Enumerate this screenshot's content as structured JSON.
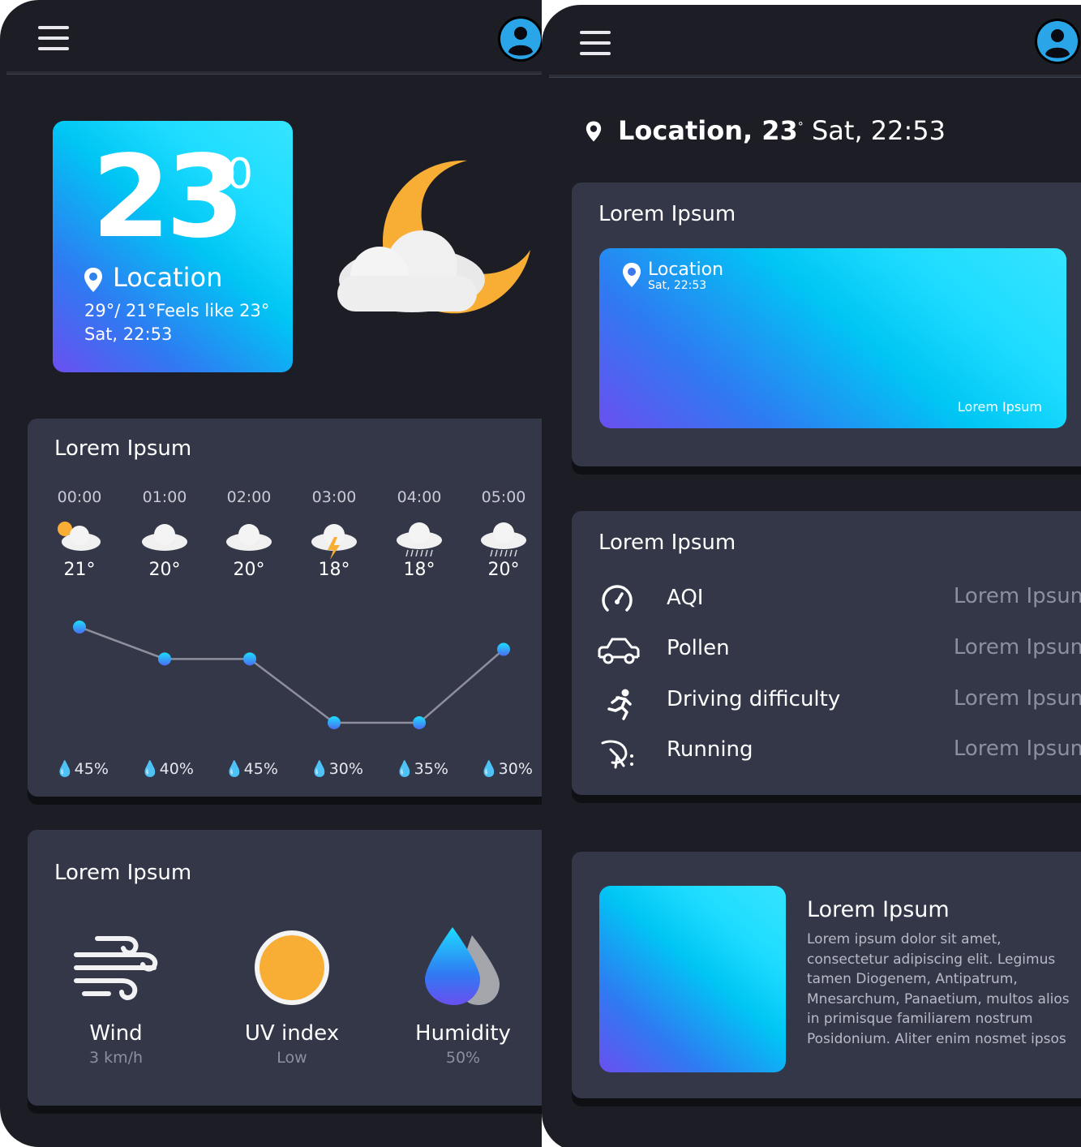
{
  "left": {
    "current": {
      "temperature": "23",
      "degree": "0",
      "location": "Location",
      "range_feels": "29°/ 21°Feels like 23°",
      "datetime": "Sat, 22:53"
    },
    "hourly": {
      "title": "Lorem Ipsum",
      "hours": [
        {
          "time": "00:00",
          "icon": "partly-cloudy-night-icon",
          "temp": "21°",
          "humidity": "45%"
        },
        {
          "time": "01:00",
          "icon": "cloud-icon",
          "temp": "20°",
          "humidity": "40%"
        },
        {
          "time": "02:00",
          "icon": "cloud-icon",
          "temp": "20°",
          "humidity": "45%"
        },
        {
          "time": "03:00",
          "icon": "thunderstorm-icon",
          "temp": "18°",
          "humidity": "30%"
        },
        {
          "time": "04:00",
          "icon": "rain-icon",
          "temp": "18°",
          "humidity": "35%"
        },
        {
          "time": "05:00",
          "icon": "rain-icon",
          "temp": "20°",
          "humidity": "30%"
        }
      ],
      "trend_values": [
        21,
        20,
        20,
        18,
        18,
        20.3
      ]
    },
    "details": {
      "title": "Lorem Ipsum",
      "items": [
        {
          "label": "Wind",
          "value": "3 km/h",
          "icon": "wind-icon"
        },
        {
          "label": "UV index",
          "value": "Low",
          "icon": "sun-icon"
        },
        {
          "label": "Humidity",
          "value": "50%",
          "icon": "humidity-drops-icon"
        }
      ]
    }
  },
  "right": {
    "header": {
      "location": "Location, 23",
      "degree": "°",
      "datetime": " Sat, 22:53"
    },
    "feature": {
      "title": "Lorem Ipsum",
      "location": "Location",
      "datetime": "Sat, 22:53",
      "link": "Lorem Ipsum"
    },
    "activities": {
      "title": "Lorem Ipsum",
      "rows": [
        {
          "icon": "speedometer-icon",
          "label": "AQI",
          "value": "Lorem Ipsum"
        },
        {
          "icon": "car-icon",
          "label": "Pollen",
          "value": "Lorem Ipsum"
        },
        {
          "icon": "running-person-icon",
          "label": "Driving difficulty",
          "value": "Lorem Ipsum"
        },
        {
          "icon": "flower-icon",
          "label": "Running",
          "value": "Lorem Ipsum"
        }
      ]
    },
    "article": {
      "title": "Lorem Ipsum",
      "body": "Lorem ipsum dolor sit amet, consectetur adipiscing elit. Legimus tamen Diogenem, Antipatrum, Mnesarchum, Panaetium, multos alios in primisque familiarem nostrum Posidonium. Aliter enim nosmet ipsos"
    }
  },
  "colors": {
    "background": "#1d1e25",
    "card": "#333748",
    "accent_cyan": "#1edcff",
    "accent_violet": "#6a4ff0",
    "moon": "#f8ae35",
    "muted_text": "#8c8fa0"
  }
}
